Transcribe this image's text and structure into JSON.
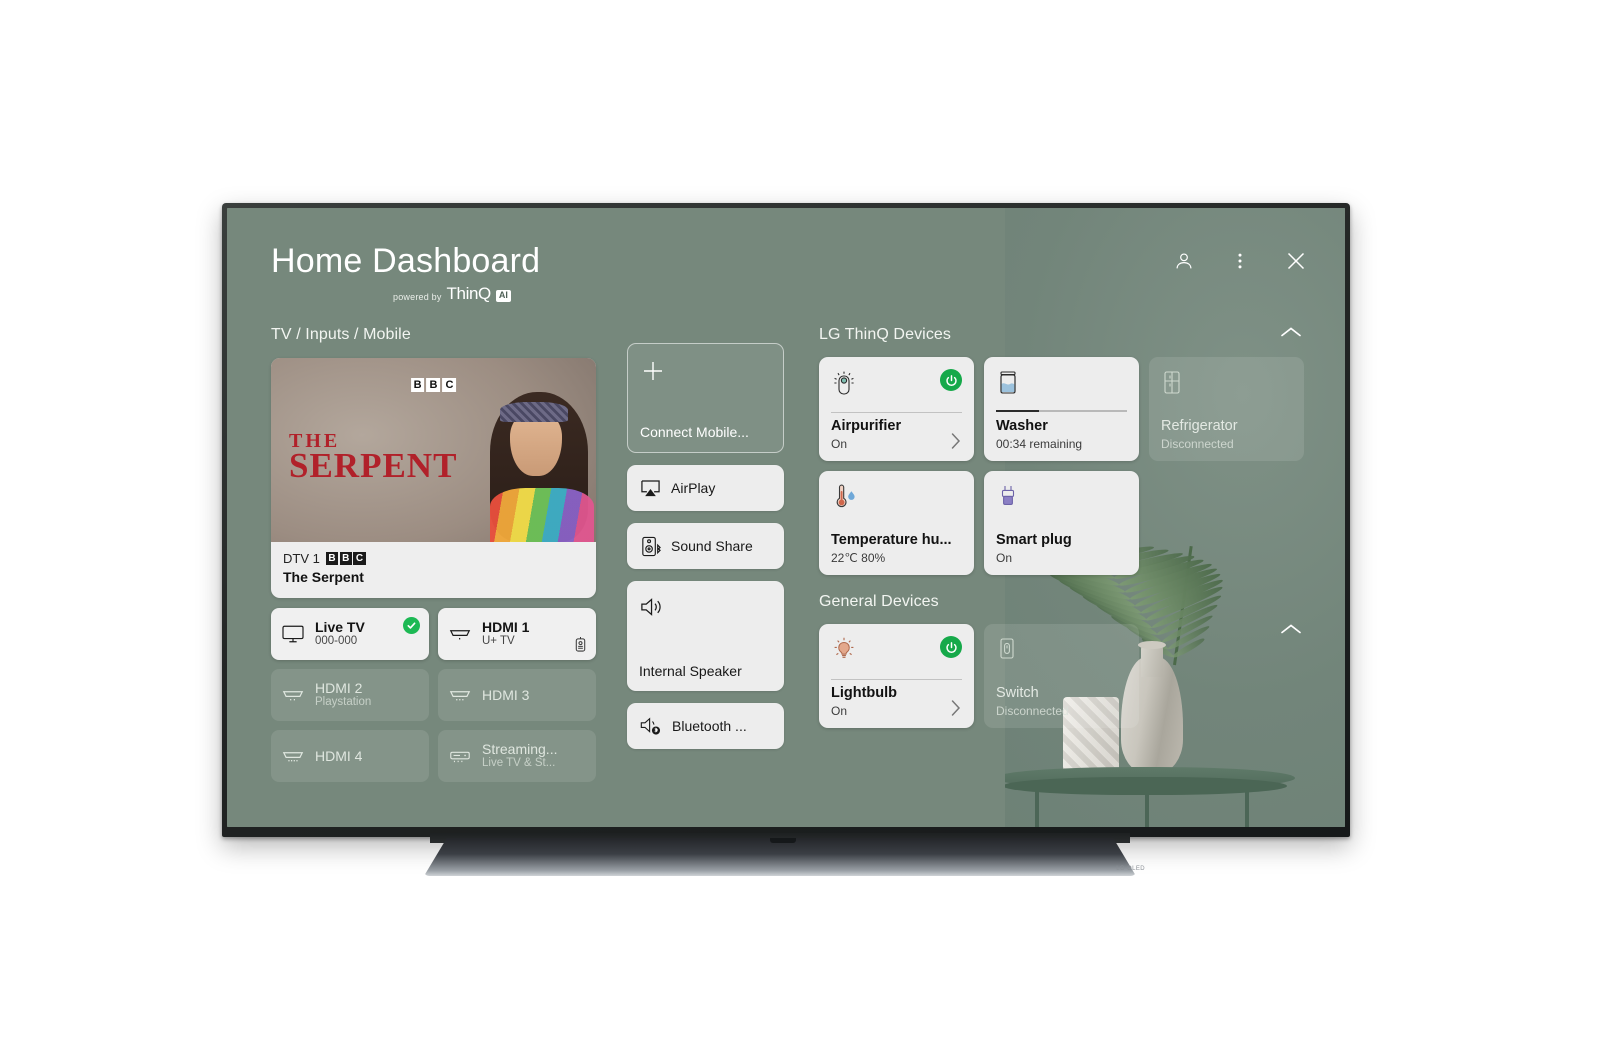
{
  "header": {
    "title": "Home Dashboard",
    "powered_by": "powered by",
    "brand": "ThinQ",
    "ai_badge": "AI",
    "actions": [
      {
        "name": "profile-icon",
        "label": "Profile"
      },
      {
        "name": "more-options-icon",
        "label": "More options"
      },
      {
        "name": "close-icon",
        "label": "Close"
      }
    ]
  },
  "left": {
    "section_title": "TV / Inputs / Mobile",
    "preview": {
      "channel_logo_letters": [
        "B",
        "B",
        "C"
      ],
      "art_title_line1": "THE",
      "art_title_line2": "SERPENT",
      "channel": "DTV 1",
      "broadcaster_letters": [
        "B",
        "B",
        "C"
      ],
      "program": "The Serpent"
    },
    "inputs": [
      {
        "name": "Live TV",
        "sub": "000-000",
        "icon": "tv-icon",
        "state": "active",
        "selected": true
      },
      {
        "name": "HDMI 1",
        "sub": "U+ TV",
        "icon": "hdmi-icon",
        "state": "active",
        "badge_icon": "set-top-box-icon"
      },
      {
        "name": "HDMI 2",
        "sub": "Playstation",
        "icon": "hdmi-icon",
        "state": "dim"
      },
      {
        "name": "HDMI 3",
        "sub": "",
        "icon": "hdmi-icon",
        "state": "dim"
      },
      {
        "name": "HDMI 4",
        "sub": "",
        "icon": "hdmi-icon",
        "state": "dim"
      },
      {
        "name": "Streaming...",
        "sub": "Live TV & St...",
        "icon": "streaming-box-icon",
        "state": "dim"
      }
    ]
  },
  "middle": {
    "connect_mobile": {
      "label": "Connect Mobile...",
      "icon": "plus-icon"
    },
    "cards": [
      {
        "label": "AirPlay",
        "icon": "airplay-icon"
      },
      {
        "label": "Sound Share",
        "icon": "sound-share-icon"
      }
    ],
    "internal_speaker": {
      "label": "Internal Speaker",
      "icon": "speaker-icon"
    },
    "bluetooth": {
      "label": "Bluetooth ...",
      "icon": "bluetooth-speaker-icon"
    }
  },
  "right": {
    "thinq_title": "LG ThinQ Devices",
    "general_title": "General Devices",
    "thinq_devices": [
      {
        "name": "Airpurifier",
        "sub": "On",
        "icon": "air-purifier-icon",
        "state": "on",
        "power": true,
        "chevron": true,
        "divider": true
      },
      {
        "name": "Washer",
        "sub": "00:34 remaining",
        "icon": "washer-icon",
        "state": "on",
        "power": false,
        "chevron": false,
        "progress": 33
      },
      {
        "name": "Refrigerator",
        "sub": "Disconnected",
        "icon": "refrigerator-icon",
        "state": "off",
        "power": false,
        "chevron": false
      },
      {
        "name": "Temperature hu...",
        "sub": "22℃ 80%",
        "icon": "temperature-humidity-icon",
        "state": "on",
        "power": false,
        "chevron": false
      },
      {
        "name": "Smart plug",
        "sub": "On",
        "icon": "smart-plug-icon",
        "state": "on",
        "power": false,
        "chevron": false
      }
    ],
    "general_devices": [
      {
        "name": "Lightbulb",
        "sub": "On",
        "icon": "lightbulb-icon",
        "state": "on",
        "power": true,
        "chevron": true,
        "divider": true
      },
      {
        "name": "Switch",
        "sub": "Disconnected",
        "icon": "switch-icon",
        "state": "off",
        "power": false,
        "chevron": false
      }
    ],
    "collapse_icons": [
      "chevron-up-icon",
      "chevron-up-icon"
    ]
  },
  "colors": {
    "background": "#76887c",
    "card_light": "#ededed",
    "accent_green": "#16a94a",
    "check_green": "#1db954",
    "text_dark": "#121212",
    "text_light": "#ffffff"
  },
  "tv": {
    "brand_mark": "LG OLED"
  }
}
